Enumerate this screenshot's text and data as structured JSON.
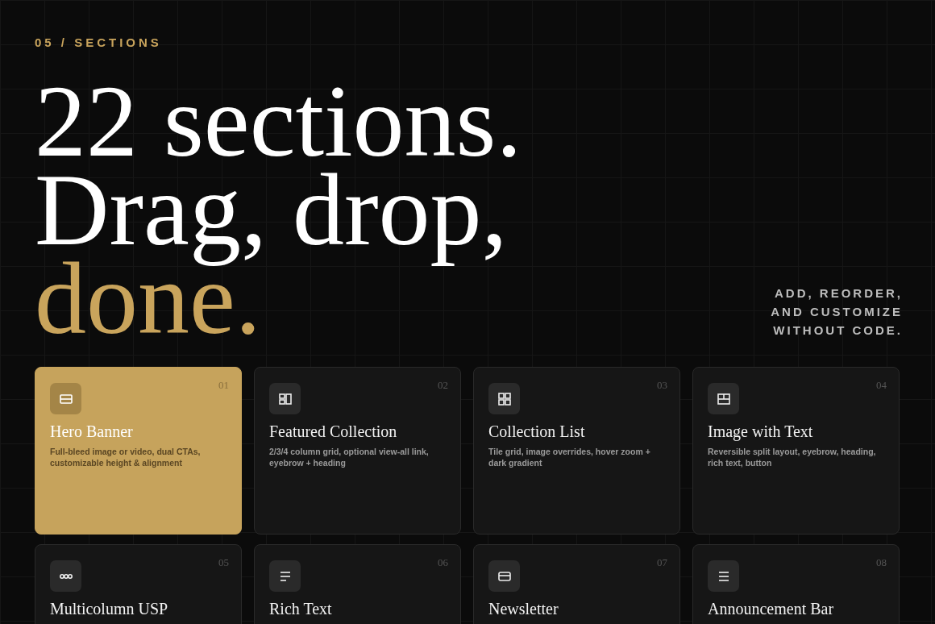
{
  "eyebrow": "05 / SECTIONS",
  "headline": [
    {
      "text": "22 sections.",
      "accent": false
    },
    {
      "text": "Drag, drop,",
      "accent": false
    },
    {
      "text": "done.",
      "accent": true
    }
  ],
  "tagline": [
    "ADD, REORDER,",
    "AND CUSTOMIZE",
    "WITHOUT CODE."
  ],
  "cards": [
    {
      "number": "01",
      "title": "Hero Banner",
      "description": "Full-bleed image or video, dual CTAs, customizable height & alignment",
      "kind": "banner",
      "selected": true
    },
    {
      "number": "02",
      "title": "Featured Collection",
      "description": "2/3/4 column grid, optional view-all link, eyebrow + heading",
      "kind": "columns",
      "selected": false
    },
    {
      "number": "03",
      "title": "Collection List",
      "description": "Tile grid, image overrides, hover zoom + dark gradient",
      "kind": "grid",
      "selected": false
    },
    {
      "number": "04",
      "title": "Image with Text",
      "description": "Reversible split layout, eyebrow, heading, rich text, button",
      "kind": "split",
      "selected": false
    },
    {
      "number": "05",
      "title": "Multicolumn USP",
      "kind": "dots",
      "selected": false
    },
    {
      "number": "06",
      "title": "Rich Text",
      "kind": "text",
      "selected": false
    },
    {
      "number": "07",
      "title": "Newsletter",
      "kind": "card",
      "selected": false
    },
    {
      "number": "08",
      "title": "Announcement Bar",
      "kind": "menu",
      "selected": false
    }
  ]
}
